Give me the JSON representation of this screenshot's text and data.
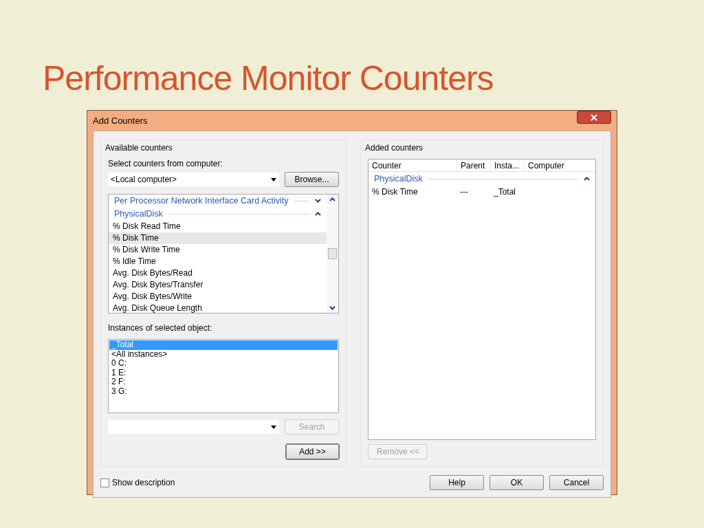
{
  "slide_title": "Performance Monitor Counters",
  "window": {
    "title": "Add Counters"
  },
  "available": {
    "label": "Available counters",
    "computer_label": "Select counters from computer:",
    "computer_value": "<Local computer>",
    "browse": "Browse...",
    "groups": [
      {
        "name": "Per Processor Network Interface Card Activity",
        "expanded": false
      },
      {
        "name": "PhysicalDisk",
        "expanded": true,
        "items": [
          {
            "label": "% Disk Read Time",
            "selected": false
          },
          {
            "label": "% Disk Time",
            "selected": true
          },
          {
            "label": "% Disk Write Time",
            "selected": false
          },
          {
            "label": "% Idle Time",
            "selected": false
          },
          {
            "label": "Avg. Disk Bytes/Read",
            "selected": false
          },
          {
            "label": "Avg. Disk Bytes/Transfer",
            "selected": false
          },
          {
            "label": "Avg. Disk Bytes/Write",
            "selected": false
          },
          {
            "label": "Avg. Disk Queue Length",
            "selected": false
          }
        ]
      }
    ],
    "instances_label": "Instances of selected object:",
    "instances": [
      {
        "label": "_Total",
        "selected": true
      },
      {
        "label": "<All instances>",
        "selected": false
      },
      {
        "label": "0 C:",
        "selected": false
      },
      {
        "label": "1 E:",
        "selected": false
      },
      {
        "label": "2 F:",
        "selected": false
      },
      {
        "label": "3 G:",
        "selected": false
      }
    ],
    "search": {
      "label": "Search",
      "disabled": true
    },
    "add": {
      "label": "Add >>",
      "default": true
    }
  },
  "added": {
    "label": "Added counters",
    "columns": [
      "Counter",
      "Parent",
      "Insta...",
      "Computer"
    ],
    "groups": [
      {
        "name": "PhysicalDisk",
        "expanded": true,
        "rows": [
          [
            "% Disk Time",
            "---",
            "_Total"
          ]
        ]
      }
    ],
    "remove": {
      "label": "Remove <<",
      "disabled": true
    }
  },
  "show_description": {
    "label": "Show description",
    "checked": false
  },
  "buttons": [
    "Help",
    "OK",
    "Cancel"
  ]
}
